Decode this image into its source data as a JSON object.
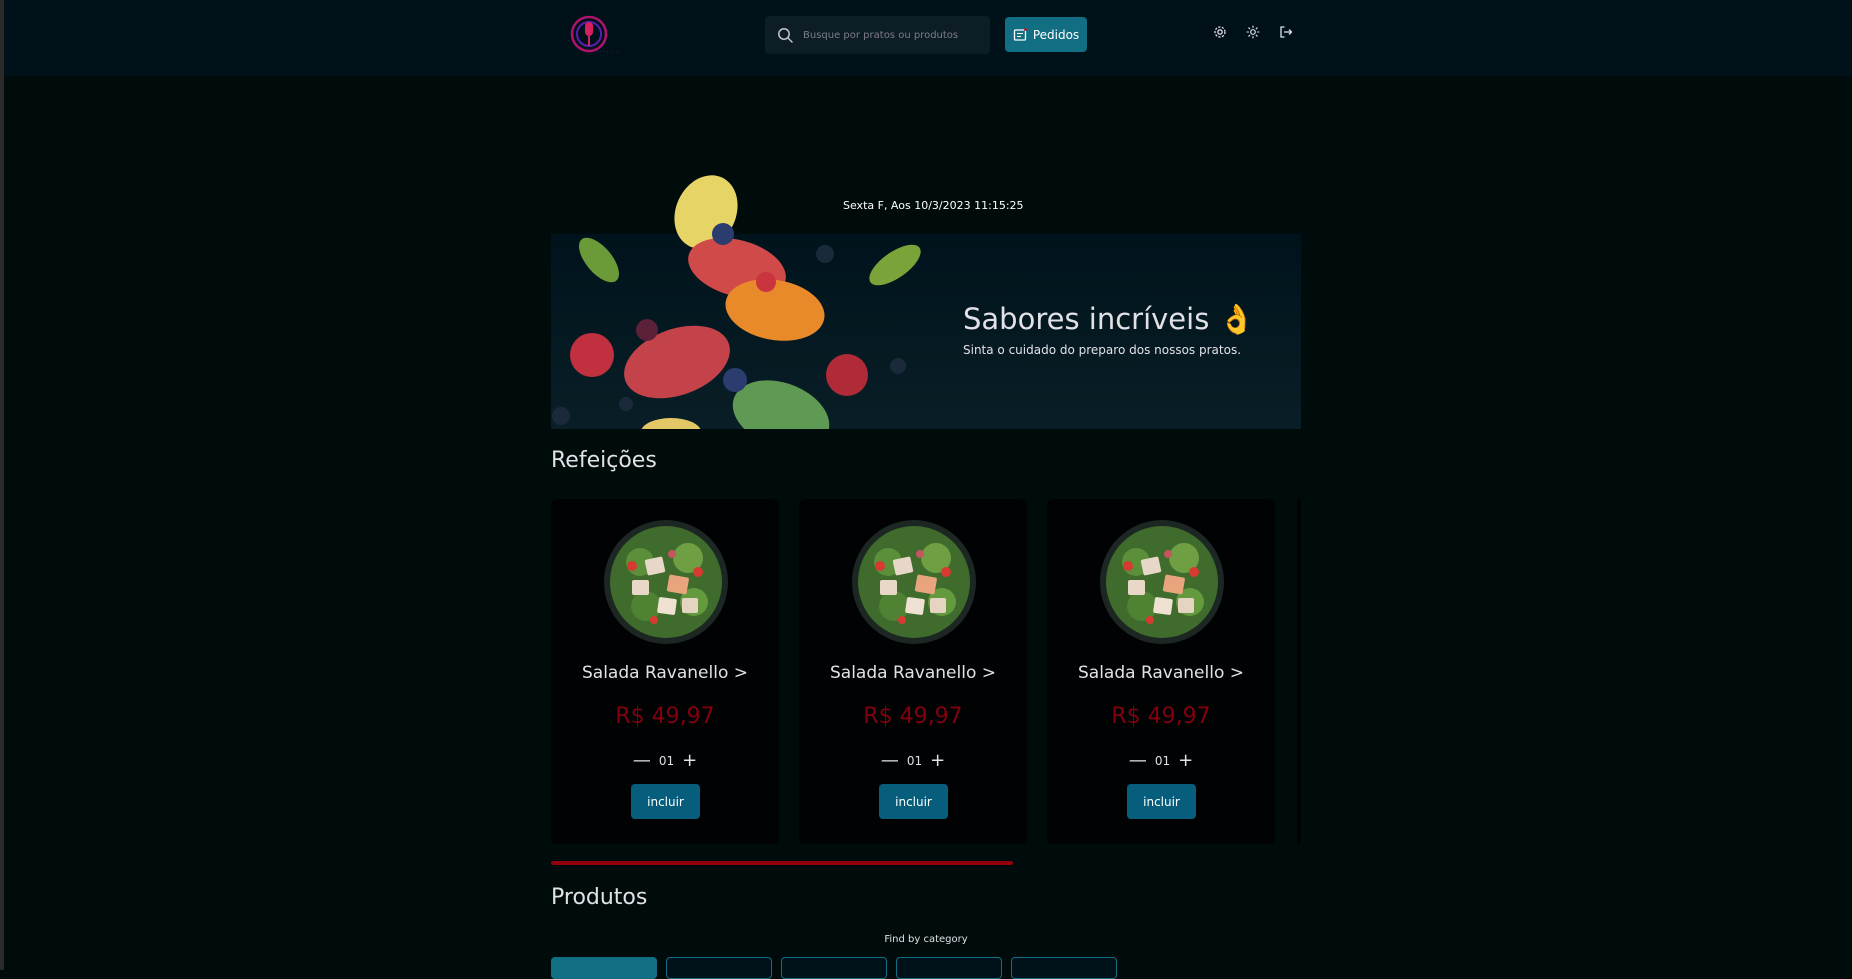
{
  "header": {
    "search_placeholder": "Busque por pratos ou produtos",
    "orders_label": "Pedidos",
    "icons": [
      "search-icon",
      "receipt-icon",
      "gear-icon",
      "sun-icon",
      "logout-icon"
    ]
  },
  "main": {
    "datetime": "Sexta F, Aos 10/3/2023 11:15:25",
    "banner": {
      "title": "Sabores incríveis 👌",
      "subtitle": "Sinta o cuidado do preparo dos nossos pratos."
    },
    "meals_title": "Refeições",
    "meals": [
      {
        "name": "Salada Ravanello >",
        "price": "R$ 49,97",
        "quantity": "01",
        "button": "incluir"
      },
      {
        "name": "Salada Ravanello >",
        "price": "R$ 49,97",
        "quantity": "01",
        "button": "incluir"
      },
      {
        "name": "Salada Ravanello >",
        "price": "R$ 49,97",
        "quantity": "01",
        "button": "incluir"
      }
    ],
    "products_title": "Produtos",
    "find_category": "Find by category"
  },
  "colors": {
    "background": "#000b0b",
    "header": "#00111a",
    "accent": "#126e82",
    "price": "#82000e",
    "scroll_indicator": "#92000e"
  }
}
